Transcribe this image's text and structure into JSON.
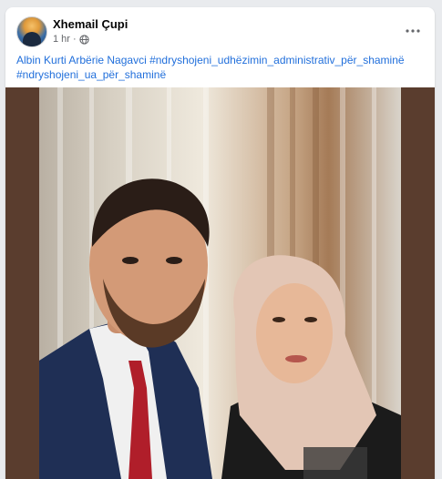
{
  "post": {
    "author_name": "Xhemail Çupi",
    "timestamp": "1 hr",
    "separator": "·",
    "privacy_icon": "globe-icon",
    "more_icon": "more-options-icon",
    "caption_line1": "Albin Kurti Arbërie Nagavci #ndryshojeni_udhëzimin_administrativ_për_shaminë",
    "caption_line2": "#ndryshojeni_ua_për_shaminë",
    "link_color": "#216fdb"
  }
}
